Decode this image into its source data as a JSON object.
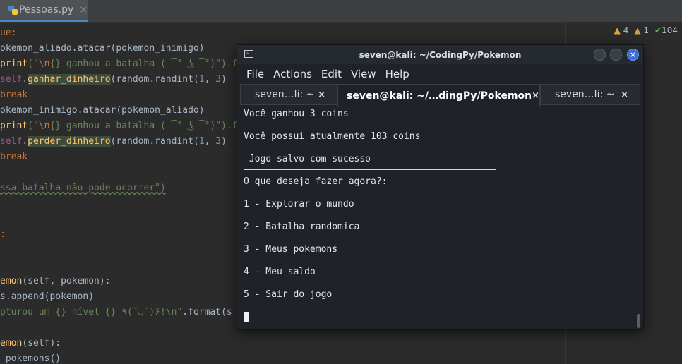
{
  "ide": {
    "tab": {
      "label": "Pessoas.py",
      "close": "×"
    },
    "inspections": {
      "warnings": "4",
      "weak": "1",
      "ok": "104"
    },
    "code": {
      "l1": "ue:",
      "l2": "okemon_aliado.atacar(pokemon_inimigo)",
      "l3a": "print",
      "l3b": "(\"",
      "l3c": "\\n",
      "l3d": "{} ganhou a batalha ( ͡° ͜ʖ ͡°)\").form",
      "l4a": "self",
      "l4b": ".",
      "l4c": "ganhar_dinheiro",
      "l4d": "(random.randint(",
      "l4e": "1",
      "l4f": ", ",
      "l4g": "3",
      "l4h": ")",
      "l5": "break",
      "l6": "okemon_inimigo.atacar(pokemon_aliado)",
      "l7a": "print",
      "l7b": "(\"",
      "l7c": "\\n",
      "l7d": "{} ganhou a batalha ( ͡° ͜ʖ ͡°)\").form",
      "l8a": "self",
      "l8b": ".",
      "l8c": "perder_dinheiro",
      "l8d": "(random.randint(",
      "l8e": "1",
      "l8f": ", ",
      "l8g": "3",
      "l8h": ")",
      "l9": "break",
      "l10": "ssa batalha não pode ocorrer\")",
      "l11": ":",
      "l12a": "emon",
      "l12b": "(self, pokemon):",
      "l13": "s.append(pokemon)",
      "l14a": "pturou um {} nível {} ٩(˘◡˘)۶!\\n\"",
      "l14b": ".format(s",
      "l15a": "emon",
      "l15b": "(self):",
      "l16": "_pokemons()"
    }
  },
  "terminal": {
    "title": "seven@kali: ~/CodingPy/Pokemon",
    "menu": [
      "File",
      "Actions",
      "Edit",
      "View",
      "Help"
    ],
    "tabs": [
      {
        "label": "seven…li: ~",
        "close": "×"
      },
      {
        "label": "seven@kali: ~/…dingPy/Pokemon",
        "close": "×"
      },
      {
        "label": "seven…li: ~",
        "close": "×"
      }
    ],
    "close_glyph": "×",
    "lines": {
      "coins_won": "Você ganhou 3 coins",
      "balance": "Você possui atualmente 103 coins",
      "saved": " Jogo salvo com sucesso",
      "prompt": "O que deseja fazer agora?:",
      "opt1": "1 - Explorar o mundo",
      "opt2": "2 - Batalha randomica",
      "opt3": "3 - Meus pokemons",
      "opt4": "4 - Meu saldo",
      "opt5": "5 - Sair do jogo"
    }
  }
}
